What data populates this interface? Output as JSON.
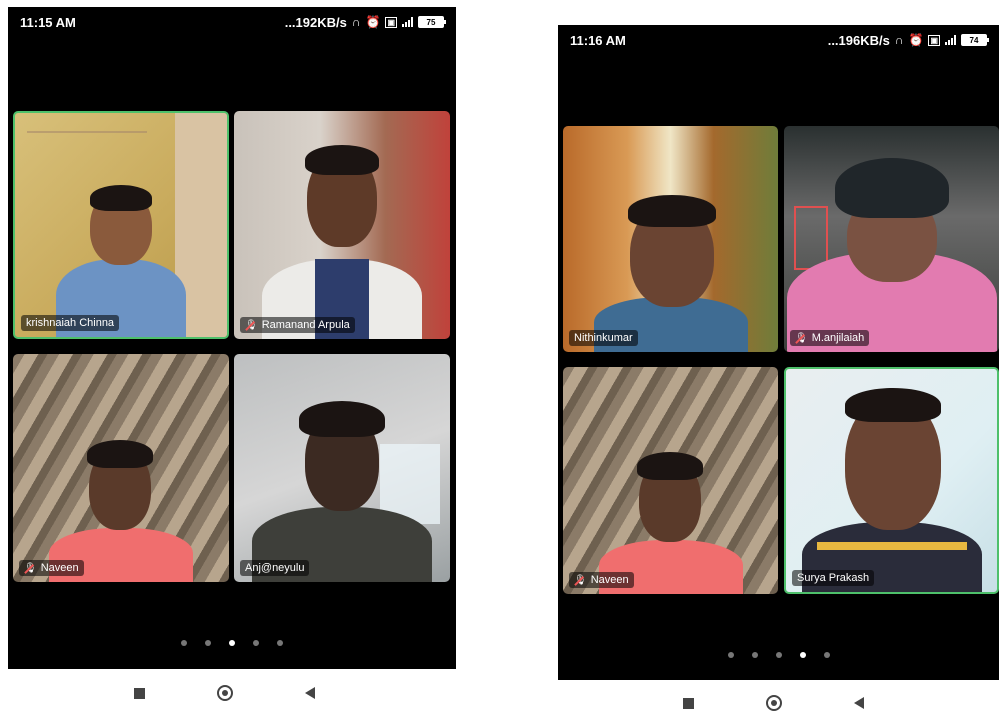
{
  "left_screen": {
    "status": {
      "time": "11:15 AM",
      "net_speed": "...192KB/s",
      "battery": "75"
    },
    "participants": [
      {
        "name": "krishnaiah Chinna",
        "muted": false,
        "speaking": true
      },
      {
        "name": "Ramanand Arpula",
        "muted": true,
        "speaking": false
      },
      {
        "name": "Naveen",
        "muted": true,
        "speaking": false
      },
      {
        "name": "Anj@neyulu",
        "muted": false,
        "speaking": false
      }
    ],
    "pager": {
      "pages": 5,
      "active": 2
    }
  },
  "right_screen": {
    "status": {
      "time": "11:16 AM",
      "net_speed": "...196KB/s",
      "battery": "74"
    },
    "participants": [
      {
        "name": "Nithinkumar",
        "muted": false,
        "speaking": false
      },
      {
        "name": "M.anjilaiah",
        "muted": true,
        "speaking": false
      },
      {
        "name": "Naveen",
        "muted": true,
        "speaking": false
      },
      {
        "name": "Surya Prakash",
        "muted": false,
        "speaking": true
      }
    ],
    "pager": {
      "pages": 5,
      "active": 3
    }
  },
  "icons": {
    "headphones": "headphones-icon",
    "alarm": "alarm-icon",
    "volte": "volte-icon",
    "signal": "signal-icon",
    "battery": "battery-icon",
    "mic_off": "mic-off-icon",
    "nav_recents": "square-icon",
    "nav_home": "circle-icon",
    "nav_back": "triangle-back-icon"
  },
  "colors": {
    "speaking_border": "#4ec06b",
    "background": "#000000"
  }
}
